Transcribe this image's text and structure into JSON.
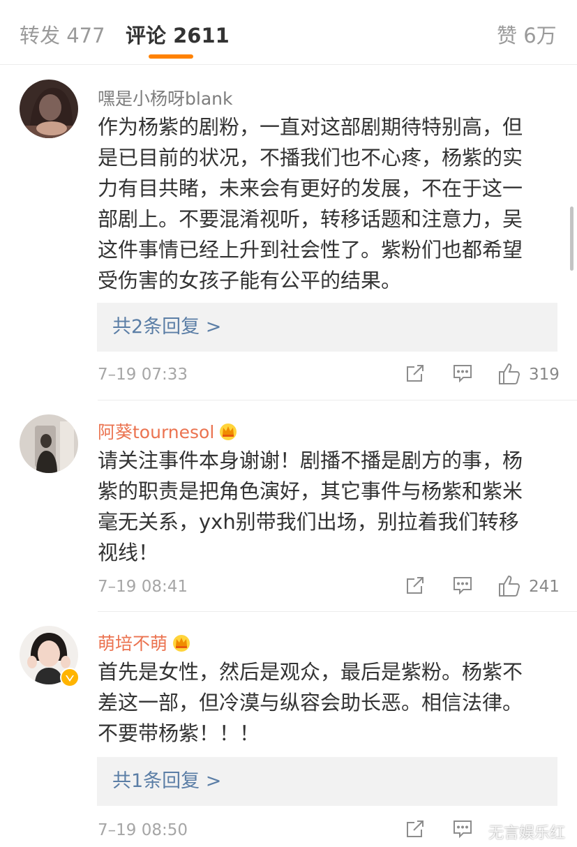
{
  "tabs": {
    "repost": "转发 477",
    "comments": "评论 2611",
    "likes": "赞 6万"
  },
  "comments": [
    {
      "username": "嘿是小杨呀blank",
      "lines": [
        "作为杨紫的剧粉，一直对这部剧期待特别高，但",
        "是已目前的状况，不播我们也不心疼，杨紫的实",
        "力有目共睹，未来会有更好的发展，不在于这一",
        "部剧上。不要混淆视听，转移话题和注意力，吴",
        "这件事情已经上升到社会性了。紫粉们也都希望",
        "受伤害的女孩子能有公平的结果。"
      ],
      "replies": "共2条回复 >",
      "time": "7–19 07:33",
      "likes": "319"
    },
    {
      "username": "阿葵tournesol",
      "lines": [
        "请关注事件本身谢谢！剧播不播是剧方的事，杨",
        "紫的职责是把角色演好，其它事件与杨紫和紫米",
        "毫无关系，yxh别带我们出场，别拉着我们转移",
        "视线！"
      ],
      "time": "7–19 08:41",
      "likes": "241"
    },
    {
      "username": "萌培不萌",
      "lines": [
        "首先是女性，然后是观众，最后是紫粉。杨紫不",
        "差这一部，但冷漠与纵容会助长恶。相信法律。",
        "不要带杨紫！！！"
      ],
      "replies": "共1条回复 >",
      "time": "7–19 08:50"
    }
  ],
  "watermark": "无言娱乐红",
  "colors": {
    "accent": "#ff8200",
    "username_orange": "#eb7350",
    "reply_link": "#5b7ea6"
  },
  "icons": [
    "share-icon",
    "comment-icon",
    "like-icon",
    "crown-icon",
    "verified-icon"
  ]
}
